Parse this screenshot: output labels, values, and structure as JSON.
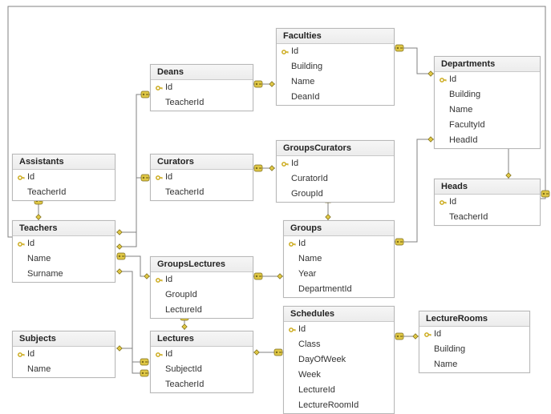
{
  "tables": {
    "faculties": {
      "title": "Faculties",
      "fields": [
        {
          "name": "Id",
          "pk": true
        },
        {
          "name": "Building",
          "pk": false
        },
        {
          "name": "Name",
          "pk": false
        },
        {
          "name": "DeanId",
          "pk": false
        }
      ]
    },
    "deans": {
      "title": "Deans",
      "fields": [
        {
          "name": "Id",
          "pk": true
        },
        {
          "name": "TeacherId",
          "pk": false
        }
      ]
    },
    "departments": {
      "title": "Departments",
      "fields": [
        {
          "name": "Id",
          "pk": true
        },
        {
          "name": "Building",
          "pk": false
        },
        {
          "name": "Name",
          "pk": false
        },
        {
          "name": "FacultyId",
          "pk": false
        },
        {
          "name": "HeadId",
          "pk": false
        }
      ]
    },
    "assistants": {
      "title": "Assistants",
      "fields": [
        {
          "name": "Id",
          "pk": true
        },
        {
          "name": "TeacherId",
          "pk": false
        }
      ]
    },
    "curators": {
      "title": "Curators",
      "fields": [
        {
          "name": "Id",
          "pk": true
        },
        {
          "name": "TeacherId",
          "pk": false
        }
      ]
    },
    "groupsCurators": {
      "title": "GroupsCurators",
      "fields": [
        {
          "name": "Id",
          "pk": true
        },
        {
          "name": "CuratorId",
          "pk": false
        },
        {
          "name": "GroupId",
          "pk": false
        }
      ]
    },
    "heads": {
      "title": "Heads",
      "fields": [
        {
          "name": "Id",
          "pk": true
        },
        {
          "name": "TeacherId",
          "pk": false
        }
      ]
    },
    "teachers": {
      "title": "Teachers",
      "fields": [
        {
          "name": "Id",
          "pk": true
        },
        {
          "name": "Name",
          "pk": false
        },
        {
          "name": "Surname",
          "pk": false
        }
      ]
    },
    "groupsLectures": {
      "title": "GroupsLectures",
      "fields": [
        {
          "name": "Id",
          "pk": true
        },
        {
          "name": "GroupId",
          "pk": false
        },
        {
          "name": "LectureId",
          "pk": false
        }
      ]
    },
    "groups": {
      "title": "Groups",
      "fields": [
        {
          "name": "Id",
          "pk": true
        },
        {
          "name": "Name",
          "pk": false
        },
        {
          "name": "Year",
          "pk": false
        },
        {
          "name": "DepartmentId",
          "pk": false
        }
      ]
    },
    "subjects": {
      "title": "Subjects",
      "fields": [
        {
          "name": "Id",
          "pk": true
        },
        {
          "name": "Name",
          "pk": false
        }
      ]
    },
    "lectures": {
      "title": "Lectures",
      "fields": [
        {
          "name": "Id",
          "pk": true
        },
        {
          "name": "SubjectId",
          "pk": false
        },
        {
          "name": "TeacherId",
          "pk": false
        }
      ]
    },
    "schedules": {
      "title": "Schedules",
      "fields": [
        {
          "name": "Id",
          "pk": true
        },
        {
          "name": "Class",
          "pk": false
        },
        {
          "name": "DayOfWeek",
          "pk": false
        },
        {
          "name": "Week",
          "pk": false
        },
        {
          "name": "LectureId",
          "pk": false
        },
        {
          "name": "LectureRoomId",
          "pk": false
        }
      ]
    },
    "lectureRooms": {
      "title": "LectureRooms",
      "fields": [
        {
          "name": "Id",
          "pk": true
        },
        {
          "name": "Building",
          "pk": false
        },
        {
          "name": "Name",
          "pk": false
        }
      ]
    }
  },
  "relationships": [
    {
      "from": "Faculties.DeanId",
      "to": "Deans.Id"
    },
    {
      "from": "Departments.FacultyId",
      "to": "Faculties.Id"
    },
    {
      "from": "Departments.HeadId",
      "to": "Heads.Id"
    },
    {
      "from": "Heads.TeacherId",
      "to": "Teachers.Id"
    },
    {
      "from": "Deans.TeacherId",
      "to": "Teachers.Id"
    },
    {
      "from": "Assistants.TeacherId",
      "to": "Teachers.Id"
    },
    {
      "from": "Curators.TeacherId",
      "to": "Teachers.Id"
    },
    {
      "from": "GroupsCurators.CuratorId",
      "to": "Curators.Id"
    },
    {
      "from": "GroupsCurators.GroupId",
      "to": "Groups.Id"
    },
    {
      "from": "Groups.DepartmentId",
      "to": "Departments.Id"
    },
    {
      "from": "GroupsLectures.GroupId",
      "to": "Groups.Id"
    },
    {
      "from": "GroupsLectures.LectureId",
      "to": "Lectures.Id"
    },
    {
      "from": "Lectures.SubjectId",
      "to": "Subjects.Id"
    },
    {
      "from": "Lectures.TeacherId",
      "to": "Teachers.Id"
    },
    {
      "from": "Schedules.LectureId",
      "to": "Lectures.Id"
    },
    {
      "from": "Schedules.LectureRoomId",
      "to": "LectureRooms.Id"
    }
  ]
}
